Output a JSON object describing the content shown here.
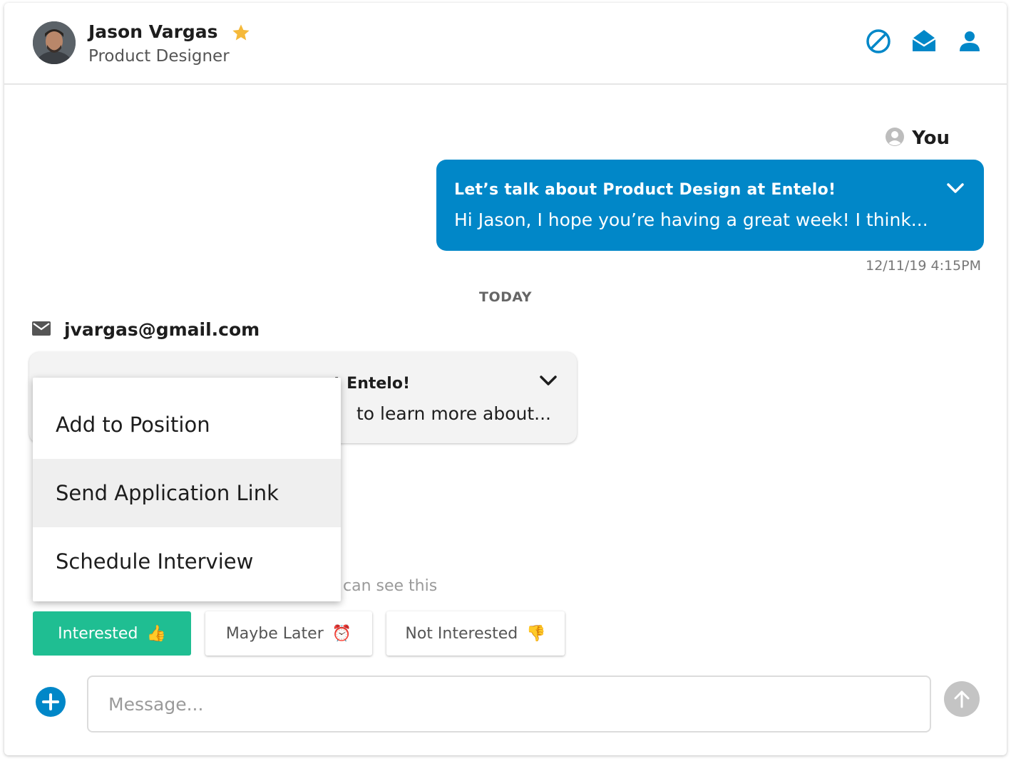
{
  "header": {
    "name": "Jason Vargas",
    "title": "Product Designer",
    "star_color": "#F5B93A",
    "accent_color": "#0187C8",
    "icons": [
      "block-icon",
      "envelope-open-icon",
      "person-icon"
    ]
  },
  "outgoing": {
    "sender": "You",
    "subject": "Let’s talk about Product Design at Entelo!",
    "preview": "Hi Jason, I hope you’re having a great week! I think...",
    "timestamp": "12/11/19 4:15PM"
  },
  "divider": {
    "label": "TODAY"
  },
  "incoming": {
    "email": "jvargas@gmail.com",
    "subject_visible": "t Entelo!",
    "preview_visible": "to learn more about..."
  },
  "note_partial": "can see this",
  "quick_replies": [
    {
      "label": "Interested",
      "emoji": "👍"
    },
    {
      "label": "Maybe Later",
      "emoji": "⏰"
    },
    {
      "label": "Not Interested",
      "emoji": "👎"
    }
  ],
  "composer": {
    "placeholder": "Message..."
  },
  "menu": {
    "items": [
      "Add to Position",
      "Send Application Link",
      "Schedule Interview"
    ],
    "highlighted_index": 1
  },
  "colors": {
    "interested_green": "#1FBE92",
    "bubble_blue": "#0187C8"
  }
}
